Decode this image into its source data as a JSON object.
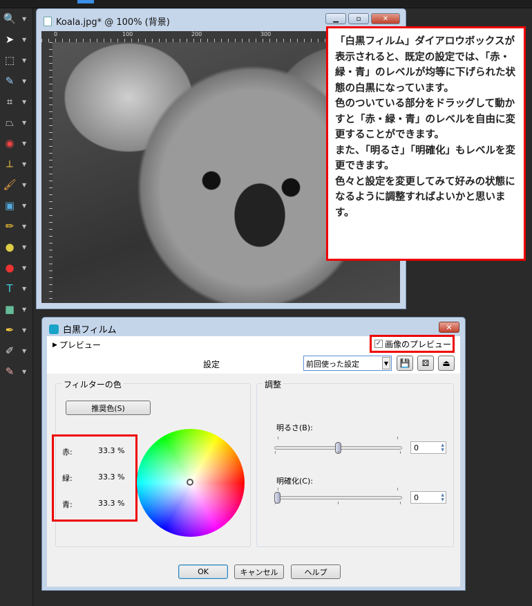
{
  "toolbar": {
    "tools": [
      "zoom-icon",
      "pick-icon",
      "selection-icon",
      "dropper-icon",
      "crop-icon",
      "perspective-icon",
      "red-eye-icon",
      "straighten-icon",
      "brush-icon",
      "picture-tube-icon",
      "lighten-icon",
      "dodge-icon",
      "color-replace-icon",
      "text-icon",
      "shape-icon",
      "pen-icon",
      "eraser-icon",
      "smudge-icon"
    ]
  },
  "image_window": {
    "title": "Koala.jpg* @ 100% (背景)",
    "ruler_labels": [
      "0",
      "100",
      "200",
      "300"
    ]
  },
  "callout": {
    "lines": [
      "「白黒フィルム」ダイアロウボックスが表示されると、既定の設定では、「赤・緑・青」のレベルが均等に下げられた状態の白黒になっています。",
      "色のついている部分をドラッグして動かすと「赤・緑・青」のレベルを自由に変更することができます。",
      "また、「明るさ」「明確化」もレベルを変更できます。",
      "色々と設定を変更してみて好みの状態になるように調整すればよいかと思います。"
    ]
  },
  "dialog": {
    "title": "白黒フィルム",
    "preview_toggle": "プレビュー",
    "image_preview_label": "画像のプレビュー",
    "image_preview_checked": true,
    "settings_label": "設定",
    "preset_value": "前回使った設定",
    "filter_color": {
      "label": "フィルターの色",
      "recommend_button": "推奨色(S)",
      "channels": [
        {
          "name": "赤:",
          "value": "33.3 %"
        },
        {
          "name": "緑:",
          "value": "33.3 %"
        },
        {
          "name": "青:",
          "value": "33.3 %"
        }
      ]
    },
    "adjust": {
      "label": "調整",
      "brightness_label": "明るさ(B):",
      "brightness_value": "0",
      "brightness_position": 0.5,
      "clarify_label": "明確化(C):",
      "clarify_value": "0",
      "clarify_position": 0
    },
    "buttons": {
      "ok": "OK",
      "cancel": "キャンセル",
      "help": "ヘルプ"
    }
  },
  "colors": {
    "highlight": "#e00000",
    "accent": "#3a8ee6"
  }
}
